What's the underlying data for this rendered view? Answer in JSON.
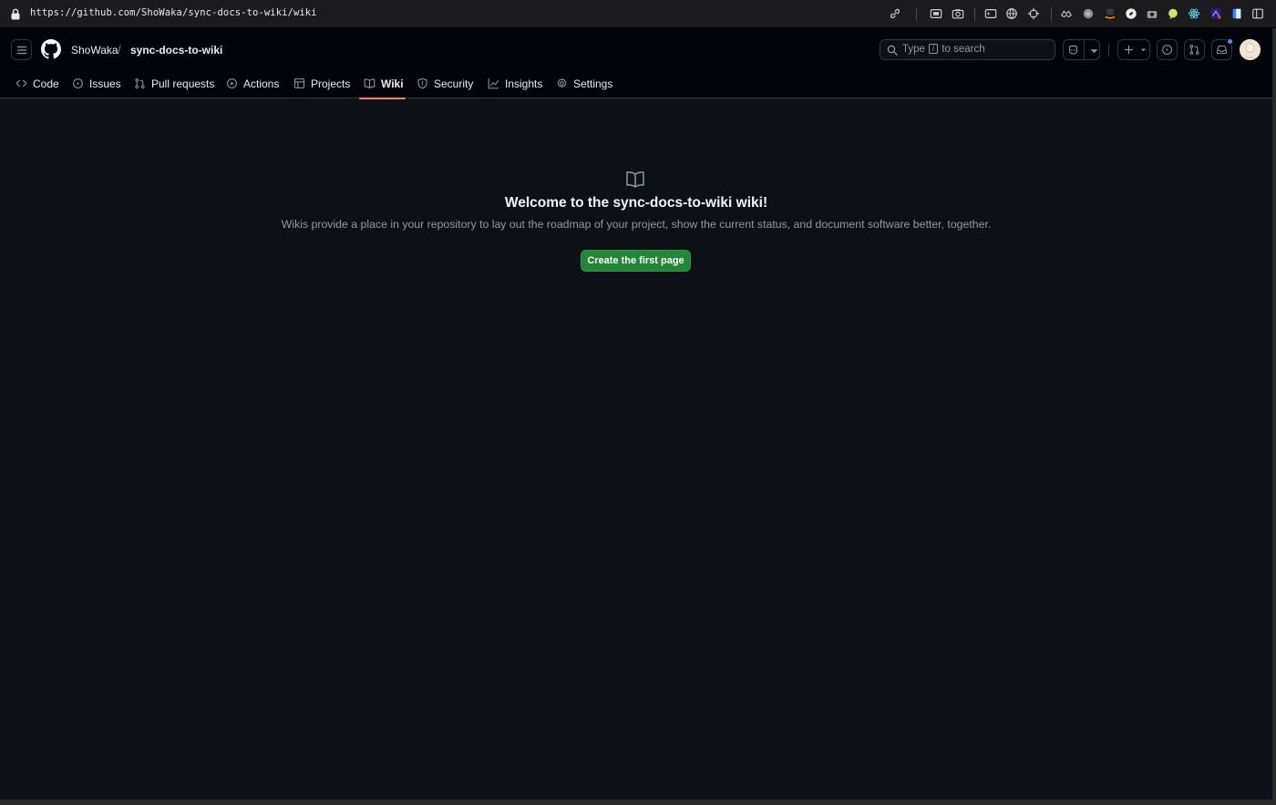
{
  "browser": {
    "url": "https://github.com/ShoWaka/sync-docs-to-wiki/wiki"
  },
  "header": {
    "owner": "ShoWaka",
    "separator": "/",
    "repo": "sync-docs-to-wiki",
    "search": {
      "prefix": "Type",
      "key": "/",
      "suffix": "to search"
    }
  },
  "tabs": [
    {
      "label": "Code",
      "icon": "code-icon"
    },
    {
      "label": "Issues",
      "icon": "issue-opened-icon"
    },
    {
      "label": "Pull requests",
      "icon": "git-pull-request-icon"
    },
    {
      "label": "Actions",
      "icon": "play-icon"
    },
    {
      "label": "Projects",
      "icon": "table-icon"
    },
    {
      "label": "Wiki",
      "icon": "book-icon",
      "active": true
    },
    {
      "label": "Security",
      "icon": "shield-icon"
    },
    {
      "label": "Insights",
      "icon": "graph-icon"
    },
    {
      "label": "Settings",
      "icon": "gear-icon"
    }
  ],
  "wiki": {
    "title": "Welcome to the sync-docs-to-wiki wiki!",
    "description": "Wikis provide a place in your repository to lay out the roadmap of your project, show the current status, and document software better, together.",
    "create_button": "Create the first page"
  },
  "colors": {
    "background": "#0d1117",
    "header": "#010409",
    "accent_underline": "#f78166",
    "primary_button": "#238636",
    "notification_dot": "#4493f8"
  }
}
